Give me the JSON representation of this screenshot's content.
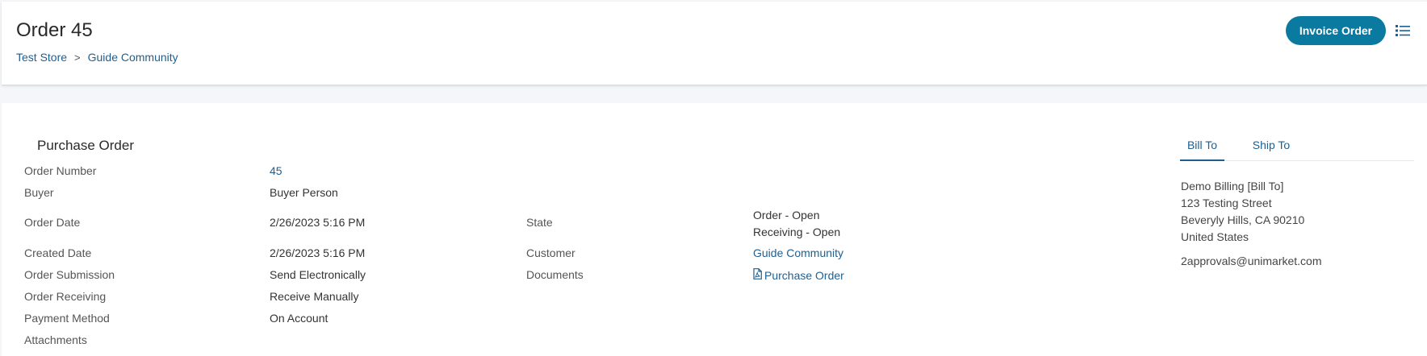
{
  "header": {
    "title": "Order 45",
    "breadcrumb": {
      "store": "Test Store",
      "separator": ">",
      "community": "Guide Community"
    },
    "invoice_button": "Invoice Order",
    "menu_icon": "list-icon"
  },
  "purchase_order": {
    "section_title": "Purchase Order",
    "fields": {
      "order_number": {
        "label": "Order Number",
        "value": "45"
      },
      "buyer": {
        "label": "Buyer",
        "value": "Buyer Person"
      },
      "order_date": {
        "label": "Order Date",
        "value": "2/26/2023 5:16 PM"
      },
      "created_date": {
        "label": "Created Date",
        "value": "2/26/2023 5:16 PM"
      },
      "order_submission": {
        "label": "Order Submission",
        "value": "Send Electronically"
      },
      "order_receiving": {
        "label": "Order Receiving",
        "value": "Receive Manually"
      },
      "payment_method": {
        "label": "Payment Method",
        "value": "On Account"
      },
      "attachments": {
        "label": "Attachments"
      },
      "state": {
        "label": "State",
        "value_line1": "Order - Open",
        "value_line2": "Receiving - Open"
      },
      "customer": {
        "label": "Customer",
        "value": "Guide Community"
      },
      "documents": {
        "label": "Documents",
        "value": "Purchase Order",
        "icon": "pdf-file-icon"
      }
    }
  },
  "address_panel": {
    "tabs": [
      "Bill To",
      "Ship To"
    ],
    "active_tab": "Bill To",
    "lines": [
      "Demo Billing [Bill To]",
      "123 Testing Street",
      "Beveryly Hills, CA 90210",
      "United States"
    ],
    "email": "2approvals@unimarket.com"
  },
  "colors": {
    "accent": "#0a7aa0",
    "link": "#1f5f8f",
    "background": "#f4f6f9"
  }
}
